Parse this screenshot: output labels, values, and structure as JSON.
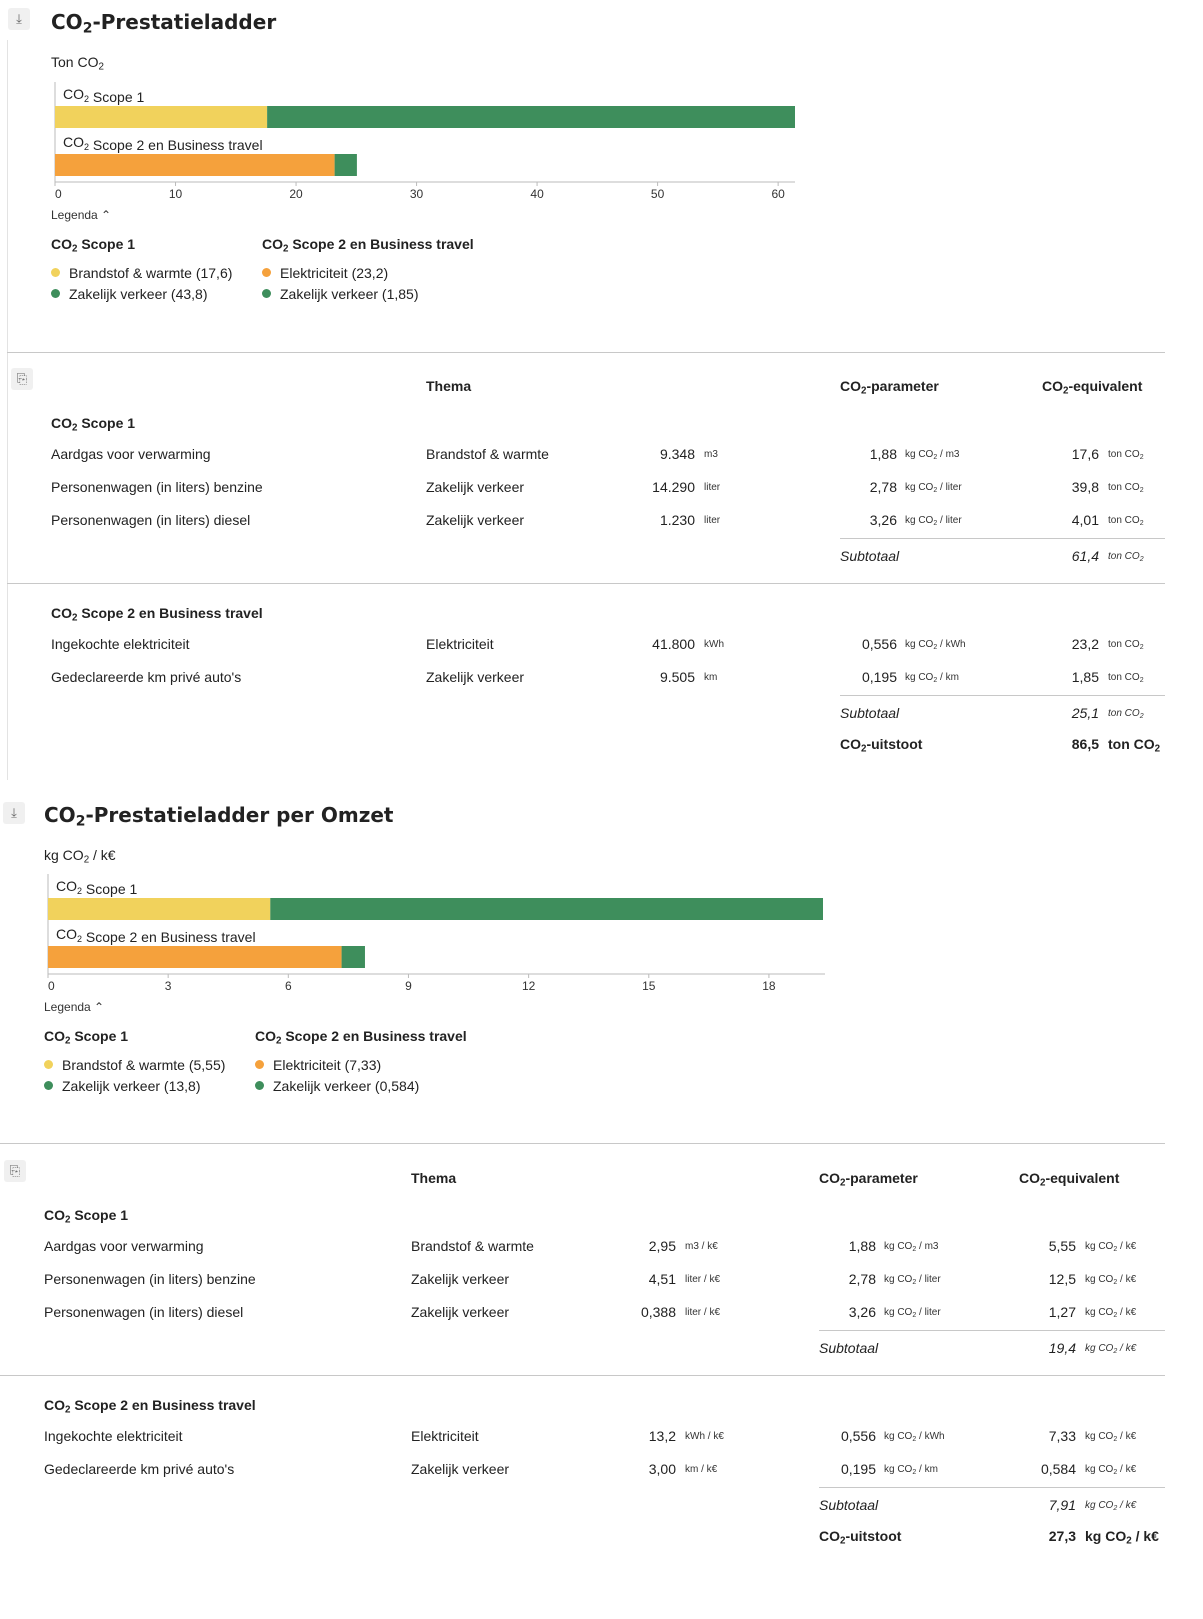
{
  "panel1": {
    "title": "CO₂-Prestatieladder",
    "unit_label": "Ton CO₂",
    "legend_toggle": "Legenda ⌃",
    "legend": {
      "groups": [
        {
          "head": "CO₂ Scope 1",
          "items": [
            "Brandstof & warmte (17,6)",
            "Zakelijk verkeer (43,8)"
          ]
        },
        {
          "head": "CO₂ Scope 2 en Business travel",
          "items": [
            "Elektriciteit (23,2)",
            "Zakelijk verkeer (1,85)"
          ]
        }
      ]
    }
  },
  "table1": {
    "headers": {
      "theme": "Thema",
      "param": "CO₂-parameter",
      "equiv": "CO₂-equivalent"
    },
    "groups": [
      {
        "head": "CO₂ Scope 1",
        "rows": [
          {
            "name": "Aardgas voor verwarming",
            "theme": "Brandstof & warmte",
            "qty": "9.348",
            "qty_unit": "m3",
            "param": "1,88",
            "param_unit": "kg CO₂ / m3",
            "equiv": "17,6",
            "equiv_unit": "ton CO₂"
          },
          {
            "name": "Personenwagen (in liters) benzine",
            "theme": "Zakelijk verkeer",
            "qty": "14.290",
            "qty_unit": "liter",
            "param": "2,78",
            "param_unit": "kg CO₂ / liter",
            "equiv": "39,8",
            "equiv_unit": "ton CO₂"
          },
          {
            "name": "Personenwagen (in liters) diesel",
            "theme": "Zakelijk verkeer",
            "qty": "1.230",
            "qty_unit": "liter",
            "param": "3,26",
            "param_unit": "kg CO₂ / liter",
            "equiv": "4,01",
            "equiv_unit": "ton CO₂"
          }
        ],
        "subtotal_label": "Subtotaal",
        "subtotal": "61,4",
        "subtotal_unit": "ton CO₂"
      },
      {
        "head": "CO₂ Scope 2 en Business travel",
        "rows": [
          {
            "name": "Ingekochte elektriciteit",
            "theme": "Elektriciteit",
            "qty": "41.800",
            "qty_unit": "kWh",
            "param": "0,556",
            "param_unit": "kg CO₂ / kWh",
            "equiv": "23,2",
            "equiv_unit": "ton CO₂"
          },
          {
            "name": "Gedeclareerde km privé auto's",
            "theme": "Zakelijk verkeer",
            "qty": "9.505",
            "qty_unit": "km",
            "param": "0,195",
            "param_unit": "kg CO₂ / km",
            "equiv": "1,85",
            "equiv_unit": "ton CO₂"
          }
        ],
        "subtotal_label": "Subtotaal",
        "subtotal": "25,1",
        "subtotal_unit": "ton CO₂"
      }
    ],
    "total_label": "CO₂-uitstoot",
    "total": "86,5",
    "total_unit": "ton CO₂"
  },
  "panel2": {
    "title": "CO₂-Prestatieladder per Omzet",
    "unit_label": "kg CO₂ / k€",
    "legend_toggle": "Legenda ⌃",
    "legend": {
      "groups": [
        {
          "head": "CO₂ Scope 1",
          "items": [
            "Brandstof & warmte (5,55)",
            "Zakelijk verkeer (13,8)"
          ]
        },
        {
          "head": "CO₂ Scope 2 en Business travel",
          "items": [
            "Elektriciteit (7,33)",
            "Zakelijk verkeer (0,584)"
          ]
        }
      ]
    }
  },
  "table2": {
    "headers": {
      "theme": "Thema",
      "param": "CO₂-parameter",
      "equiv": "CO₂-equivalent"
    },
    "groups": [
      {
        "head": "CO₂ Scope 1",
        "rows": [
          {
            "name": "Aardgas voor verwarming",
            "theme": "Brandstof & warmte",
            "qty": "2,95",
            "qty_unit": "m3 / k€",
            "param": "1,88",
            "param_unit": "kg CO₂ / m3",
            "equiv": "5,55",
            "equiv_unit": "kg CO₂ / k€"
          },
          {
            "name": "Personenwagen (in liters) benzine",
            "theme": "Zakelijk verkeer",
            "qty": "4,51",
            "qty_unit": "liter / k€",
            "param": "2,78",
            "param_unit": "kg CO₂ / liter",
            "equiv": "12,5",
            "equiv_unit": "kg CO₂ / k€"
          },
          {
            "name": "Personenwagen (in liters) diesel",
            "theme": "Zakelijk verkeer",
            "qty": "0,388",
            "qty_unit": "liter / k€",
            "param": "3,26",
            "param_unit": "kg CO₂ / liter",
            "equiv": "1,27",
            "equiv_unit": "kg CO₂ / k€"
          }
        ],
        "subtotal_label": "Subtotaal",
        "subtotal": "19,4",
        "subtotal_unit": "kg CO₂ / k€"
      },
      {
        "head": "CO₂ Scope 2 en Business travel",
        "rows": [
          {
            "name": "Ingekochte elektriciteit",
            "theme": "Elektriciteit",
            "qty": "13,2",
            "qty_unit": "kWh / k€",
            "param": "0,556",
            "param_unit": "kg CO₂ / kWh",
            "equiv": "7,33",
            "equiv_unit": "kg CO₂ / k€"
          },
          {
            "name": "Gedeclareerde km privé auto's",
            "theme": "Zakelijk verkeer",
            "qty": "3,00",
            "qty_unit": "km / k€",
            "param": "0,195",
            "param_unit": "kg CO₂ / km",
            "equiv": "0,584",
            "equiv_unit": "kg CO₂ / k€"
          }
        ],
        "subtotal_label": "Subtotaal",
        "subtotal": "7,91",
        "subtotal_unit": "kg CO₂ / k€"
      }
    ],
    "total_label": "CO₂-uitstoot",
    "total": "27,3",
    "total_unit": "kg CO₂ / k€"
  },
  "icons": {
    "download": "download-icon",
    "clipboard": "clipboard-icon"
  },
  "colors": {
    "yellow": "#f1d25c",
    "green": "#3e8e5c",
    "orange": "#f5a13c",
    "axis": "#bbbbbb"
  },
  "chart_data": [
    {
      "type": "bar",
      "orientation": "horizontal",
      "stacked": true,
      "categories": [
        "CO₂ Scope 1",
        "CO₂ Scope 2 en Business travel"
      ],
      "series": [
        {
          "name": "Brandstof & warmte",
          "color": "#f1d25c",
          "values": [
            17.6,
            0
          ]
        },
        {
          "name": "Zakelijk verkeer",
          "color": "#3e8e5c",
          "values": [
            43.8,
            0
          ]
        },
        {
          "name": "Elektriciteit",
          "color": "#f5a13c",
          "values": [
            0,
            23.2
          ]
        },
        {
          "name": "Zakelijk verkeer",
          "color": "#3e8e5c",
          "values": [
            0,
            1.85
          ]
        }
      ],
      "xlim": [
        0,
        61.4
      ],
      "xticks": [
        "0",
        "10",
        "20",
        "30",
        "40",
        "50",
        "60"
      ],
      "ylabel": "Ton CO₂",
      "legend": "bottom"
    },
    {
      "type": "bar",
      "orientation": "horizontal",
      "stacked": true,
      "categories": [
        "CO₂ Scope 1",
        "CO₂ Scope 2 en Business travel"
      ],
      "series": [
        {
          "name": "Brandstof & warmte",
          "color": "#f1d25c",
          "values": [
            5.55,
            0
          ]
        },
        {
          "name": "Zakelijk verkeer",
          "color": "#3e8e5c",
          "values": [
            13.8,
            0
          ]
        },
        {
          "name": "Elektriciteit",
          "color": "#f5a13c",
          "values": [
            0,
            7.33
          ]
        },
        {
          "name": "Zakelijk verkeer",
          "color": "#3e8e5c",
          "values": [
            0,
            0.584
          ]
        }
      ],
      "xlim": [
        0,
        19.4
      ],
      "xticks": [
        "0",
        "3",
        "6",
        "9",
        "12",
        "15",
        "18"
      ],
      "ylabel": "kg CO₂ / k€",
      "legend": "bottom"
    }
  ]
}
